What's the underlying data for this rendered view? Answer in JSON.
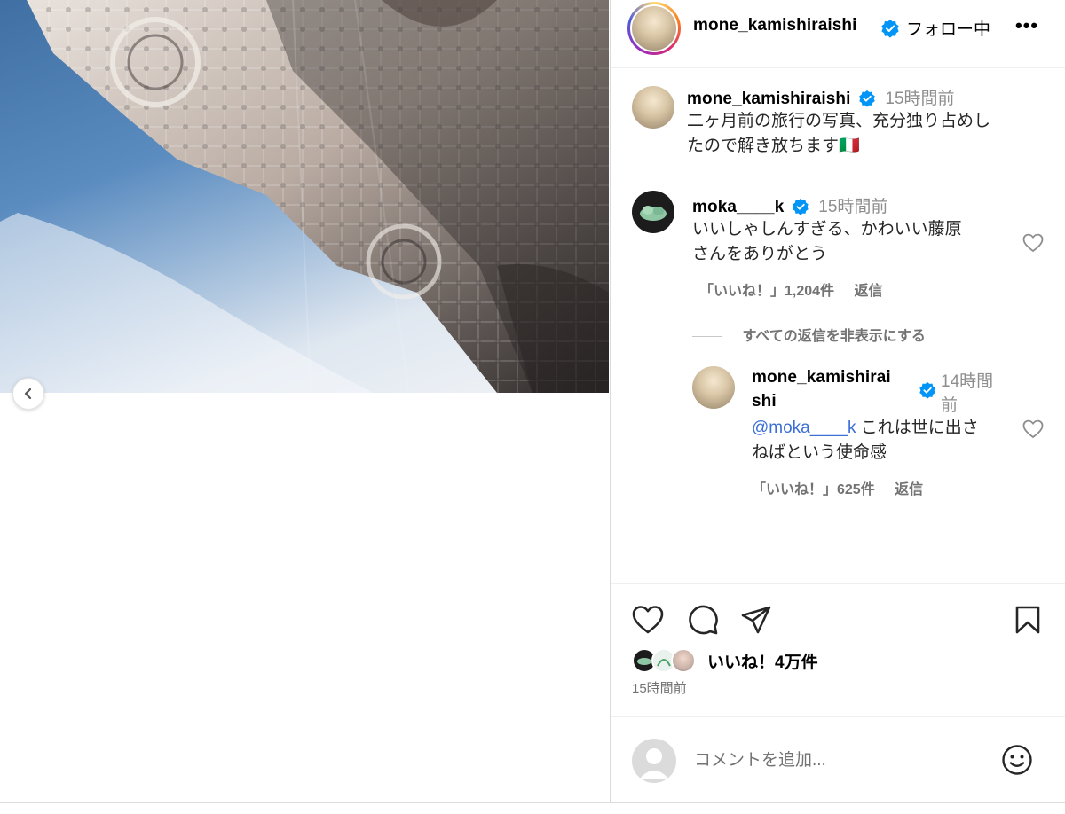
{
  "post": {
    "author": "mone_kamishiraishi",
    "follow_status": "フォロー中",
    "more": "•••",
    "caption": {
      "username": "mone_kamishiraishi",
      "time": "15時間前",
      "line1": "二ヶ月前の旅行の写真、充分独り占めし",
      "line2": "たので解き放ちます🇮🇹"
    }
  },
  "comments": [
    {
      "username": "moka____k",
      "time": "15時間前",
      "line1": "いいしゃしんすぎる、かわいい藤原",
      "line2": "さんをありがとう",
      "likes": "「いいね！」1,204件",
      "reply": "返信",
      "hide_replies": "すべての返信を非表示にする"
    }
  ],
  "reply": {
    "username_line1": "mone_kamishirai",
    "username_line2": "shi",
    "time_line1": "14時間",
    "time_line2": "前",
    "mention": "@moka____k",
    "text_line1": " これは世に出さ",
    "text_line2": "ねばという使命感",
    "likes": "「いいね！」625件",
    "reply": "返信"
  },
  "engagement": {
    "likes_label": "いいね！4万件",
    "post_time": "15時間前"
  },
  "comment_box": {
    "placeholder": "コメントを追加..."
  },
  "icons": [
    "chevron-left-icon",
    "verified-icon",
    "heart-icon",
    "comment-icon",
    "share-icon",
    "bookmark-icon",
    "emoji-icon"
  ],
  "colors": {
    "verified": "#0095f6",
    "link": "#00376b",
    "mention": "#3b6fd6"
  }
}
